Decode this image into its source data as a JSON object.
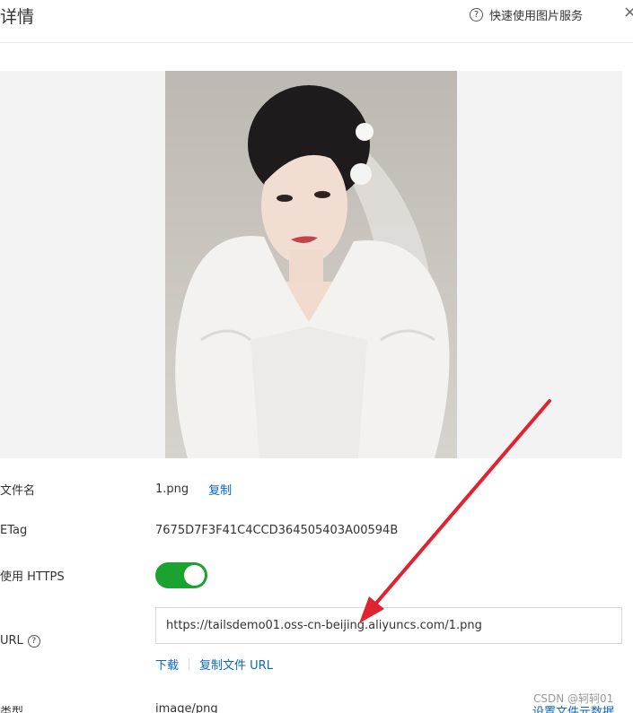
{
  "header": {
    "title": "详情",
    "help_link": "快速使用图片服务",
    "close_glyph": "×"
  },
  "preview": {
    "background": "#f3f3f3"
  },
  "fields": {
    "filename": {
      "label": "文件名",
      "value": "1.png",
      "copy_label": "复制"
    },
    "etag": {
      "label": "ETag",
      "value": "7675D7F3F41C4CCD364505403A00594B"
    },
    "https": {
      "label": "使用 HTTPS",
      "enabled": true
    },
    "url": {
      "label": "URL",
      "value": "https://tailsdemo01.oss-cn-beijing.aliyuncs.com/1.png",
      "download_label": "下载",
      "copy_url_label": "复制文件 URL"
    },
    "type": {
      "label": "类型",
      "value": "image/png",
      "meta_link": "设置文件元数据"
    }
  },
  "watermark": "CSDN @轲轲01",
  "colors": {
    "accent": "#0a66c2",
    "toggle_on": "#1aa32e",
    "annotation_arrow": "#e02330"
  }
}
